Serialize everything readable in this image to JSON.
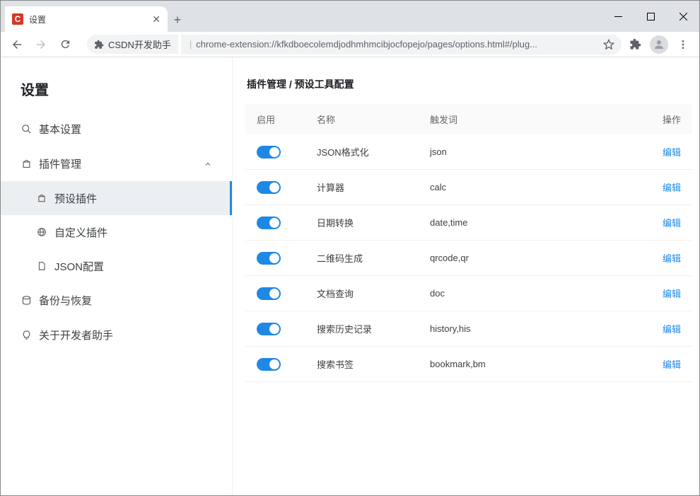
{
  "window": {
    "tab_title": "设置",
    "favicon_letter": "C",
    "ext_label": "CSDN开发助手",
    "url": "chrome-extension://kfkdboecolemdjodhmhmcibjocfopejo/pages/options.html#/plug..."
  },
  "sidebar": {
    "title": "设置",
    "items": {
      "basic": "基本设置",
      "plugin": "插件管理",
      "preset": "预设插件",
      "custom": "自定义插件",
      "json": "JSON配置",
      "backup": "备份与恢复",
      "about": "关于开发者助手"
    }
  },
  "breadcrumb": "插件管理 / 预设工具配置",
  "table": {
    "headers": {
      "enable": "启用",
      "name": "名称",
      "trigger": "触发词",
      "action": "操作"
    },
    "edit_label": "编辑",
    "rows": [
      {
        "name": "JSON格式化",
        "trigger": "json"
      },
      {
        "name": "计算器",
        "trigger": "calc"
      },
      {
        "name": "日期转换",
        "trigger": "date,time"
      },
      {
        "name": "二维码生成",
        "trigger": "qrcode,qr"
      },
      {
        "name": "文档查询",
        "trigger": "doc"
      },
      {
        "name": "搜索历史记录",
        "trigger": "history,his"
      },
      {
        "name": "搜索书签",
        "trigger": "bookmark,bm"
      }
    ]
  }
}
